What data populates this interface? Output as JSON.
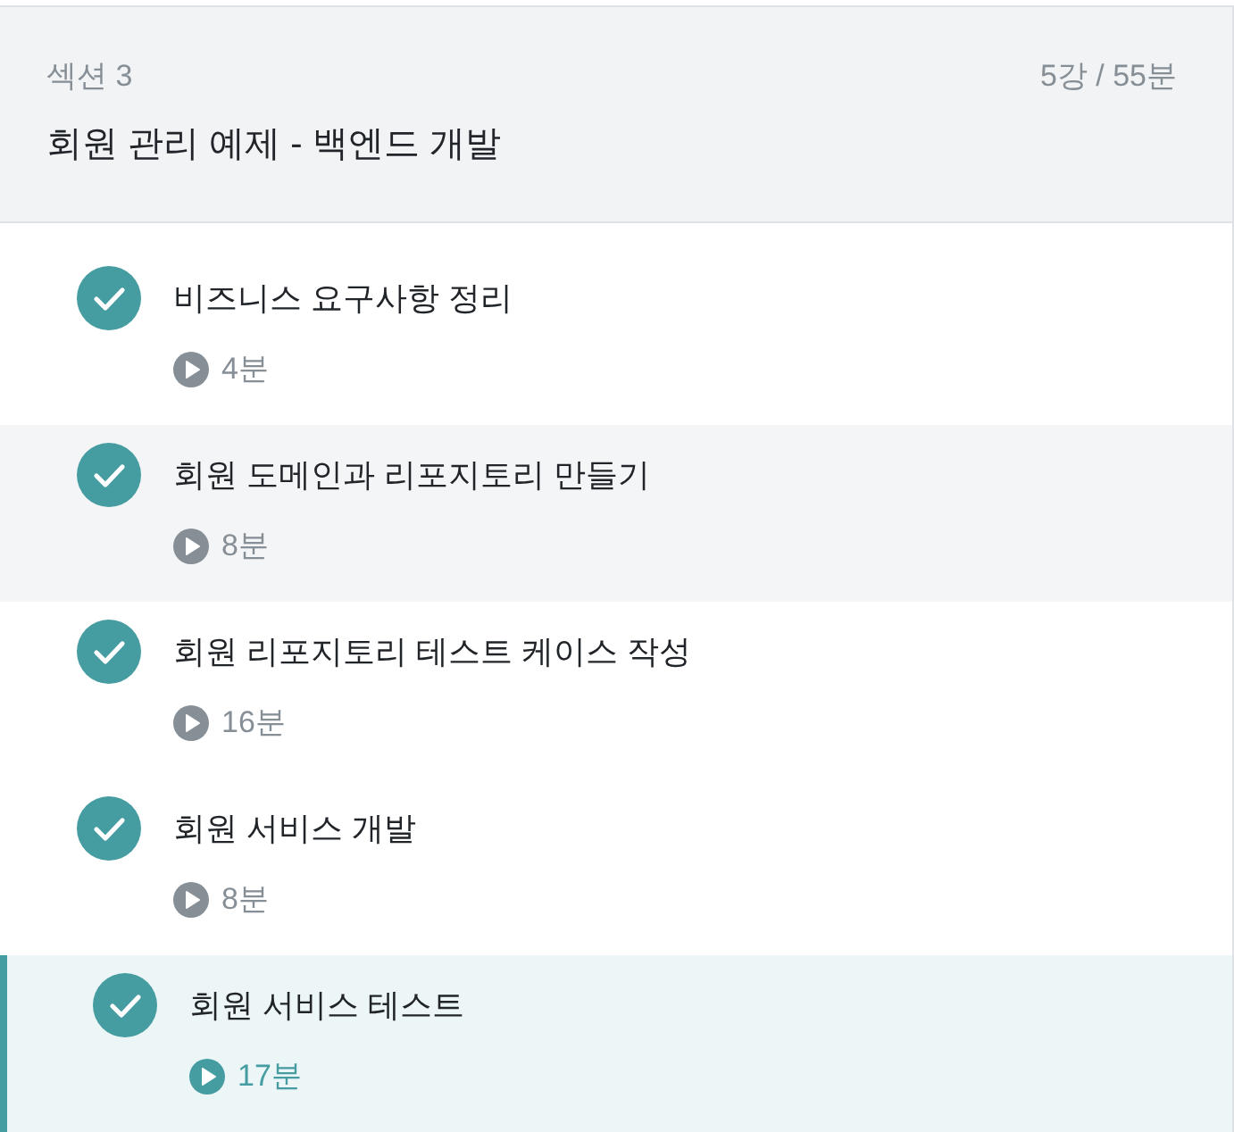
{
  "section": {
    "label": "섹션 3",
    "summary": "5강 / 55분",
    "title": "회원 관리 예제 - 백엔드 개발"
  },
  "lectures": [
    {
      "title": "비즈니스 요구사항 정리",
      "duration": "4분",
      "completed": true,
      "hovered": false,
      "selected": false
    },
    {
      "title": "회원 도메인과 리포지토리 만들기",
      "duration": "8분",
      "completed": true,
      "hovered": true,
      "selected": false
    },
    {
      "title": "회원 리포지토리 테스트 케이스 작성",
      "duration": "16분",
      "completed": true,
      "hovered": false,
      "selected": false
    },
    {
      "title": "회원 서비스 개발",
      "duration": "8분",
      "completed": true,
      "hovered": false,
      "selected": false
    },
    {
      "title": "회원 서비스 테스트",
      "duration": "17분",
      "completed": true,
      "hovered": false,
      "selected": true
    }
  ]
}
